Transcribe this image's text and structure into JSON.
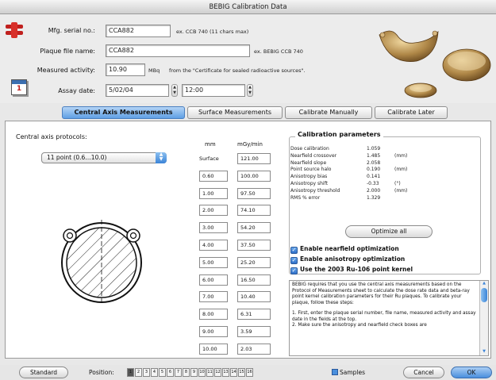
{
  "window": {
    "title": "BEBIG Calibration Data"
  },
  "form": {
    "serial_label": "Mfg. serial no.:",
    "serial_value": "CCA882",
    "serial_hint": "ex. CCB 740  (11 chars max)",
    "plaque_label": "Plaque file name:",
    "plaque_value": "CCA882",
    "plaque_hint": "ex. BEBIG CCB 740",
    "activity_label": "Measured activity:",
    "activity_value": "10.90",
    "activity_unit": "MBq",
    "activity_hint": "from the \"Certificate for sealed radioactive sources\".",
    "date_label": "Assay date:",
    "date_value": "5/02/04",
    "time_value": "12:00",
    "calendar_day": "1"
  },
  "tabs": [
    {
      "label": "Central Axis Measurements",
      "active": true
    },
    {
      "label": "Surface Measurements",
      "active": false
    },
    {
      "label": "Calibrate Manually",
      "active": false
    },
    {
      "label": "Calibrate Later",
      "active": false
    }
  ],
  "protocol": {
    "label": "Central axis protocols:",
    "selected": "11 point (0.6…10.0)"
  },
  "table": {
    "col_mm": "mm",
    "col_dose": "mGy/min",
    "rows": [
      {
        "mm": "Surface",
        "dose": "121.00"
      },
      {
        "mm": "0.60",
        "dose": "100.00"
      },
      {
        "mm": "1.00",
        "dose": "97.50"
      },
      {
        "mm": "2.00",
        "dose": "74.10"
      },
      {
        "mm": "3.00",
        "dose": "54.20"
      },
      {
        "mm": "4.00",
        "dose": "37.50"
      },
      {
        "mm": "5.00",
        "dose": "25.20"
      },
      {
        "mm": "6.00",
        "dose": "16.50"
      },
      {
        "mm": "7.00",
        "dose": "10.40"
      },
      {
        "mm": "8.00",
        "dose": "6.31"
      },
      {
        "mm": "9.00",
        "dose": "3.59"
      },
      {
        "mm": "10.00",
        "dose": "2.03"
      }
    ]
  },
  "calibration": {
    "title": "Calibration parameters",
    "params": [
      {
        "name": "Dose calibration",
        "value": "1.059",
        "unit": ""
      },
      {
        "name": "Nearfield crossover",
        "value": "1.485",
        "unit": "(mm)"
      },
      {
        "name": "Nearfield slope",
        "value": "2.058",
        "unit": ""
      },
      {
        "name": "Point source halo",
        "value": "0.190",
        "unit": "(mm)"
      },
      {
        "name": "Anisotropy bias",
        "value": "0.141",
        "unit": ""
      },
      {
        "name": "Anisotropy shift",
        "value": "-0.33",
        "unit": "(°)"
      },
      {
        "name": "Anisotropy threshold",
        "value": "2.000",
        "unit": "(mm)"
      },
      {
        "name": "RMS % error",
        "value": "1.329",
        "unit": ""
      }
    ],
    "optimize_label": "Optimize all",
    "checks": [
      {
        "label": "Enable nearfield optimization",
        "checked": true
      },
      {
        "label": "Enable anisotropy optimization",
        "checked": true
      },
      {
        "label": "Use the 2003 Ru-106 point kernel",
        "checked": true
      }
    ]
  },
  "help": {
    "text_1": "BEBIG requires that you use the central axis measurements based on the Protocol of Measurements sheet to calculate the dose rate data and beta-ray point kernel calibration parameters for their Ru plaques. To calibrate your plaque, follow these steps:",
    "text_2": "1. First, enter the plaque serial number, file name, measured activity and assay date in the fields at the top.",
    "text_3": "2. Make sure the anisotropy and nearfield check boxes are"
  },
  "bottom": {
    "standard_label": "Standard",
    "position_label": "Position:",
    "position_segments": [
      "1",
      "2",
      "3",
      "4",
      "5",
      "6",
      "7",
      "8",
      "9",
      "10",
      "11",
      "12",
      "13",
      "14",
      "15",
      "16"
    ],
    "samples_label": "Samples",
    "cancel_label": "Cancel",
    "ok_label": "OK"
  },
  "colors": {
    "accent": "#3b84d8",
    "tab_active": "#5f9fe4"
  }
}
